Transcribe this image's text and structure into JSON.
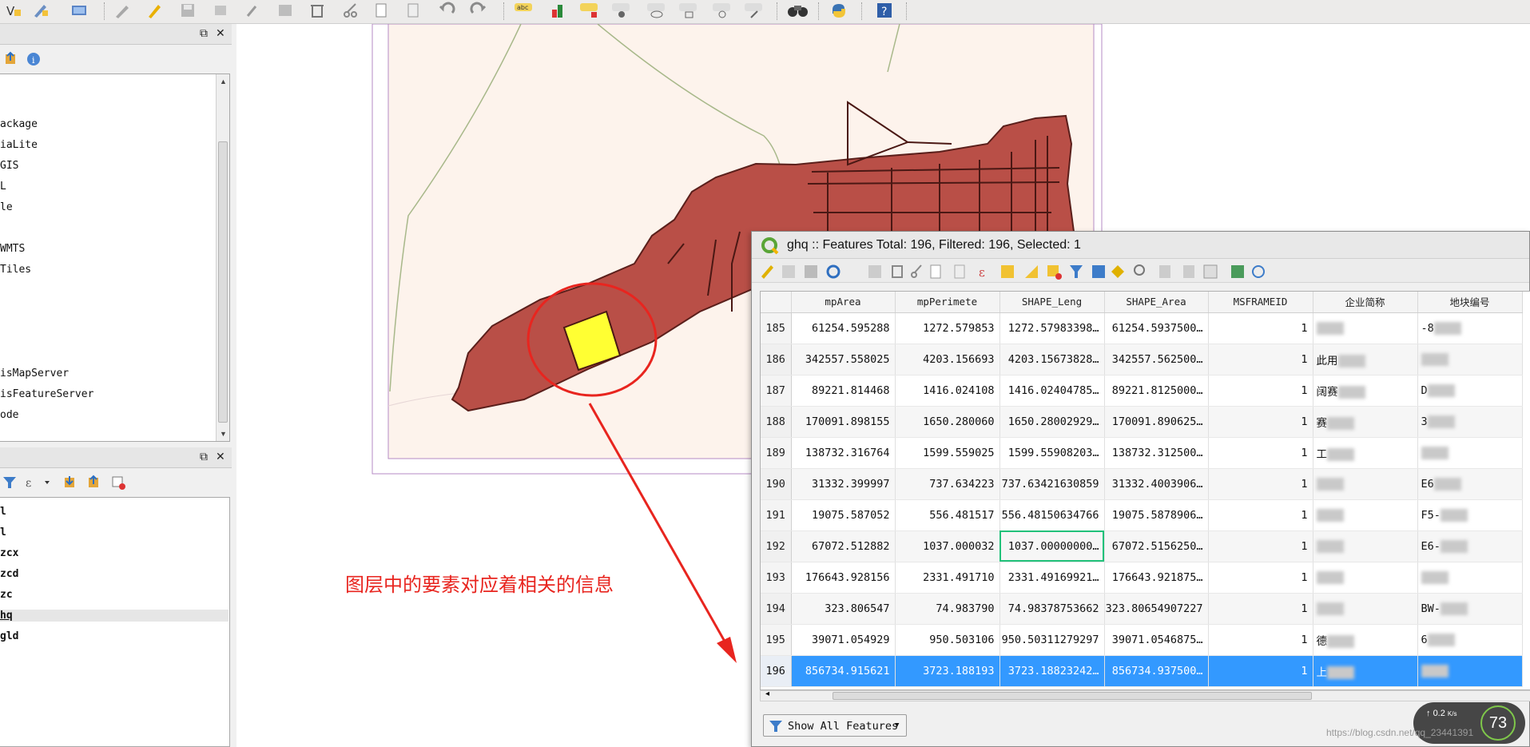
{
  "left_panels": {
    "browser_items": [
      "ackage",
      "iaLite",
      "GIS",
      "L",
      "le",
      "WMTS",
      "Tiles",
      "isMapServer",
      "isFeatureServer",
      "ode"
    ],
    "layer_items": [
      "l",
      "l",
      "zcx",
      "zcd",
      "zc",
      "hq",
      "gld"
    ]
  },
  "annotation": "图层中的要素对应着相关的信息",
  "attribute_table": {
    "title": "ghq :: Features Total: 196, Filtered: 196, Selected: 1",
    "columns": [
      "mpArea",
      "mpPerimete",
      "SHAPE_Leng",
      "SHAPE_Area",
      "MSFRAMEID",
      "企业简称",
      "地块编号"
    ],
    "rows": [
      {
        "id": "185",
        "mpArea": "61254.595288",
        "mpPerimete": "1272.579853",
        "SHAPE_Leng": "1272.57983398…",
        "SHAPE_Area": "61254.5937500…",
        "MSFRAMEID": "1",
        "short": "",
        "code": "-8"
      },
      {
        "id": "186",
        "mpArea": "342557.558025",
        "mpPerimete": "4203.156693",
        "SHAPE_Leng": "4203.15673828…",
        "SHAPE_Area": "342557.562500…",
        "MSFRAMEID": "1",
        "short": "此用",
        "code": ""
      },
      {
        "id": "187",
        "mpArea": "89221.814468",
        "mpPerimete": "1416.024108",
        "SHAPE_Leng": "1416.02404785…",
        "SHAPE_Area": "89221.8125000…",
        "MSFRAMEID": "1",
        "short": "阔赛",
        "code": "D"
      },
      {
        "id": "188",
        "mpArea": "170091.898155",
        "mpPerimete": "1650.280060",
        "SHAPE_Leng": "1650.28002929…",
        "SHAPE_Area": "170091.890625…",
        "MSFRAMEID": "1",
        "short": "赛",
        "code": "3"
      },
      {
        "id": "189",
        "mpArea": "138732.316764",
        "mpPerimete": "1599.559025",
        "SHAPE_Leng": "1599.55908203…",
        "SHAPE_Area": "138732.312500…",
        "MSFRAMEID": "1",
        "short": "工",
        "code": ""
      },
      {
        "id": "190",
        "mpArea": "31332.399997",
        "mpPerimete": "737.634223",
        "SHAPE_Leng": "737.63421630859",
        "SHAPE_Area": "31332.4003906…",
        "MSFRAMEID": "1",
        "short": "",
        "code": "E6"
      },
      {
        "id": "191",
        "mpArea": "19075.587052",
        "mpPerimete": "556.481517",
        "SHAPE_Leng": "556.48150634766",
        "SHAPE_Area": "19075.5878906…",
        "MSFRAMEID": "1",
        "short": "",
        "code": "F5-"
      },
      {
        "id": "192",
        "mpArea": "67072.512882",
        "mpPerimete": "1037.000032",
        "SHAPE_Leng": "1037.00000000…",
        "SHAPE_Area": "67072.5156250…",
        "MSFRAMEID": "1",
        "short": "",
        "code": "E6-"
      },
      {
        "id": "193",
        "mpArea": "176643.928156",
        "mpPerimete": "2331.491710",
        "SHAPE_Leng": "2331.49169921…",
        "SHAPE_Area": "176643.921875…",
        "MSFRAMEID": "1",
        "short": "",
        "code": ""
      },
      {
        "id": "194",
        "mpArea": "323.806547",
        "mpPerimete": "74.983790",
        "SHAPE_Leng": "74.98378753662",
        "SHAPE_Area": "323.80654907227",
        "MSFRAMEID": "1",
        "short": "",
        "code": "BW-"
      },
      {
        "id": "195",
        "mpArea": "39071.054929",
        "mpPerimete": "950.503106",
        "SHAPE_Leng": "950.50311279297",
        "SHAPE_Area": "39071.0546875…",
        "MSFRAMEID": "1",
        "short": "德",
        "code": "6"
      },
      {
        "id": "196",
        "mpArea": "856734.915621",
        "mpPerimete": "3723.188193",
        "SHAPE_Leng": "3723.18823242…",
        "SHAPE_Area": "856734.937500…",
        "MSFRAMEID": "1",
        "short": "上",
        "code": ""
      }
    ],
    "selected_row": "196",
    "show_all_label": "Show All Features",
    "network": {
      "speed_up": "0.2",
      "unit": "K/s",
      "level": "73"
    }
  },
  "watermark": "https://blog.csdn.net/qq_23441391"
}
